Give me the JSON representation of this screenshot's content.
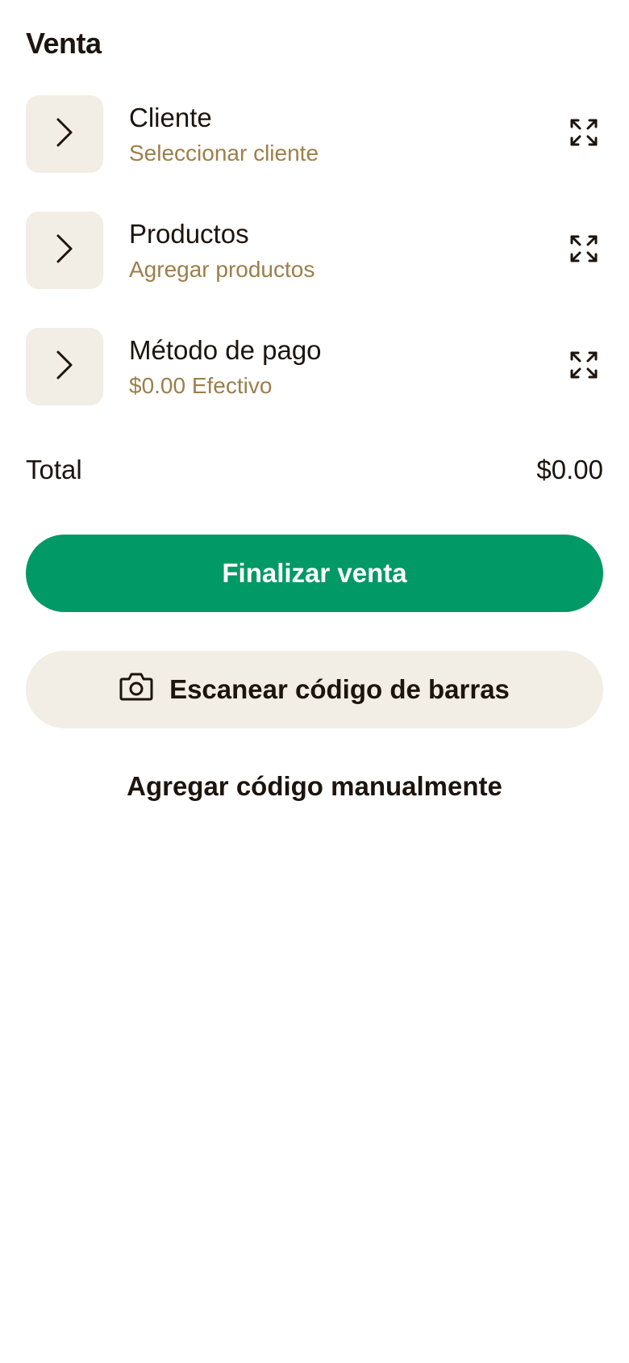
{
  "header": {
    "title": "Venta"
  },
  "rows": [
    {
      "label": "Cliente",
      "sub": "Seleccionar cliente",
      "icon_left": "chevron-right-icon",
      "icon_right": "expand-icon"
    },
    {
      "label": "Productos",
      "sub": "Agregar productos",
      "icon_left": "chevron-right-icon",
      "icon_right": "expand-icon"
    },
    {
      "label": "Método de pago",
      "sub": "$0.00 Efectivo",
      "icon_left": "chevron-right-icon",
      "icon_right": "expand-icon"
    }
  ],
  "total": {
    "label": "Total",
    "value": "$0.00"
  },
  "actions": {
    "finalize_label": "Finalizar venta",
    "scan_label": "Escanear código de barras",
    "scan_icon": "camera-icon",
    "manual_label": "Agregar código manualmente"
  },
  "colors": {
    "primary": "#019966",
    "surface": "#f2ede5",
    "text": "#1c140d",
    "secondary_text": "#9c7f4a"
  }
}
